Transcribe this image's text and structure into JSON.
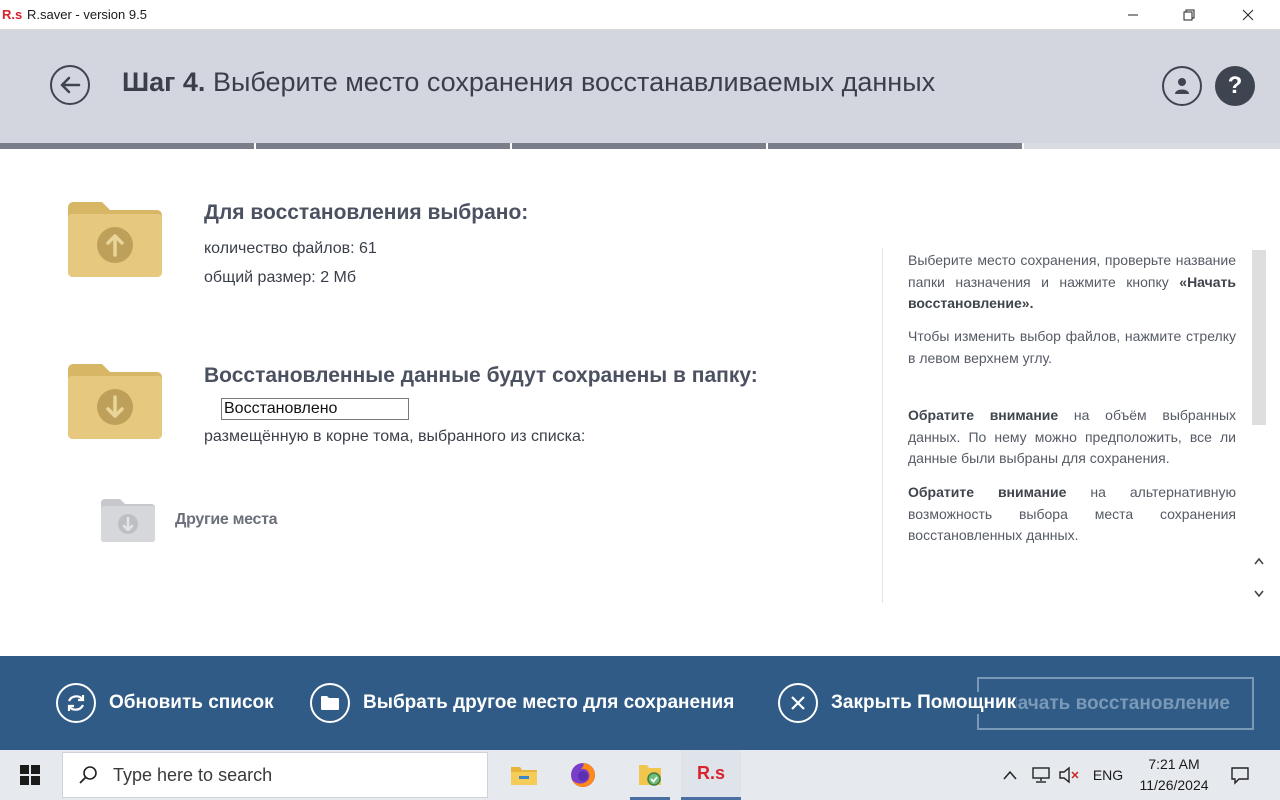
{
  "window": {
    "logo": "R.s",
    "title": "R.saver - version 9.5",
    "minimize_icon": "minimize-icon",
    "maximize_icon": "restore-icon",
    "close_icon": "close-icon"
  },
  "header": {
    "step_label": "Шаг 4.",
    "step_text": "Выберите место сохранения восстанавливаемых данных",
    "back_icon": "arrow-left-icon",
    "user_icon": "user-icon",
    "help_label": "?"
  },
  "progress": {
    "total_steps": 5,
    "completed_steps": 4,
    "done_color": "#7a7e8a",
    "pending_color": "#d9dce2"
  },
  "selected": {
    "title": "Для восстановления выбрано:",
    "file_count": "количество файлов: 61",
    "total_size": "общий размер: 2 Мб",
    "icon": "folder-upload-icon"
  },
  "destination": {
    "title": "Восстановленные данные будут сохранены в папку:",
    "folder_value": "Восстановлено",
    "note": "размещённую в корне тома, выбранного из списка:",
    "icon": "folder-download-icon"
  },
  "other_places": {
    "label": "Другие места",
    "icon": "folder-gray-icon"
  },
  "help_panel": {
    "p1_text": "Выберите место сохранения, проверьте название папки назначения и нажмите кнопку",
    "p1_bold": "«Начать восстановление».",
    "p2_text": "Чтобы изменить выбор файлов, нажмите стрелку в левом верхнем углу.",
    "p3_bold": "Обратите внимание",
    "p3_text": "на объём выбранных данных. По нему можно предположить, все ли данные были выбраны для сохранения.",
    "p4_bold": "Обратите внимание",
    "p4_text": "на альтернативную возможность выбора места сохранения восстановленных данных."
  },
  "actions": {
    "refresh": "Обновить список",
    "choose_other": "Выбрать другое место для сохранения",
    "close_wizard": "Закрыть Помощник",
    "start_recovery": "Начать восстановление"
  },
  "colors": {
    "header_bg": "#d3d6de",
    "action_bar_bg": "#2f5b86",
    "folder_gold": "#e2c37a",
    "accent_red": "#d9232e"
  },
  "taskbar": {
    "search_placeholder": "Type here to search",
    "apps": [
      "file-explorer-icon",
      "firefox-icon",
      "search-files-icon",
      "rsaver-icon"
    ],
    "rsaver_label": "R.s",
    "language": "ENG",
    "time": "7:21 AM",
    "date": "11/26/2024"
  }
}
